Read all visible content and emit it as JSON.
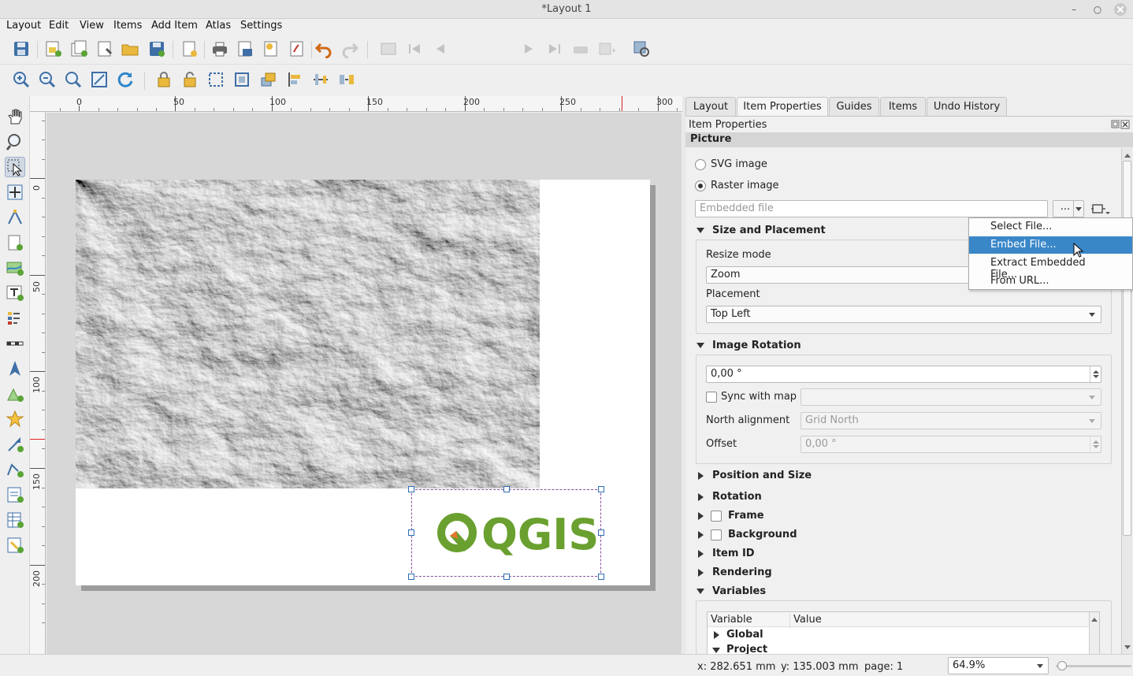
{
  "window": {
    "title": "*Layout 1"
  },
  "menubar": [
    "Layout",
    "Edit",
    "View",
    "Items",
    "Add Item",
    "Atlas",
    "Settings"
  ],
  "toolbar": {
    "atlas_page_value": "1"
  },
  "icons": {
    "save": "save-icon",
    "new_layout": "new-layout-icon",
    "duplicate": "duplicate-layout-icon",
    "layout_manager": "layout-manager-icon",
    "open": "open-template-icon",
    "save_template": "save-as-template-icon",
    "add_pages": "add-pages-icon",
    "print": "print-icon",
    "export_image": "export-image-icon",
    "export_svg": "export-svg-icon",
    "export_pdf": "export-pdf-icon",
    "undo": "undo-icon",
    "redo": "redo-icon"
  },
  "ruler": {
    "top_ticks": [
      "0",
      "50",
      "100",
      "150",
      "200",
      "250",
      "300"
    ],
    "left_ticks": [
      "0",
      "50",
      "100",
      "150",
      "200"
    ]
  },
  "canvas": {
    "logo_text": "QGIS"
  },
  "tabs": [
    {
      "label": "Layout",
      "active": false
    },
    {
      "label": "Item Properties",
      "active": true
    },
    {
      "label": "Guides",
      "active": false
    },
    {
      "label": "Items",
      "active": false
    },
    {
      "label": "Undo History",
      "active": false
    }
  ],
  "panel": {
    "title": "Item Properties",
    "section": "Picture",
    "svg_image_label": "SVG image",
    "raster_image_label": "Raster image",
    "source_field_placeholder": "Embedded file",
    "browse_button": "...",
    "size_placement": {
      "title": "Size and Placement",
      "resize_mode_label": "Resize mode",
      "resize_mode_value": "Zoom",
      "placement_label": "Placement",
      "placement_value": "Top Left"
    },
    "image_rotation": {
      "title": "Image Rotation",
      "rotation_value": "0,00 °",
      "sync_label": "Sync with map",
      "north_label": "North alignment",
      "north_value": "Grid North",
      "offset_label": "Offset",
      "offset_value": "0,00 °"
    },
    "collapsed_groups": [
      "Position and Size",
      "Rotation"
    ],
    "checkable_groups": [
      "Frame",
      "Background"
    ],
    "more_groups": [
      "Item ID",
      "Rendering"
    ],
    "variables": {
      "title": "Variables",
      "columns": [
        "Variable",
        "Value"
      ],
      "rows": [
        "Global",
        "Project"
      ]
    }
  },
  "dropdown_menu": {
    "items": [
      "Select File...",
      "Embed File...",
      "Extract Embedded File...",
      "From URL..."
    ],
    "highlighted_index": 1
  },
  "status": {
    "x": "x: 282.651 mm",
    "y": "y: 135.003 mm",
    "page": "page: 1",
    "zoom": "64.9%"
  },
  "colors": {
    "accent": "#3a87c8",
    "qgis_green": "#6aa02f",
    "qgis_orange": "#e8762d",
    "selection": "#8a4f9e"
  }
}
